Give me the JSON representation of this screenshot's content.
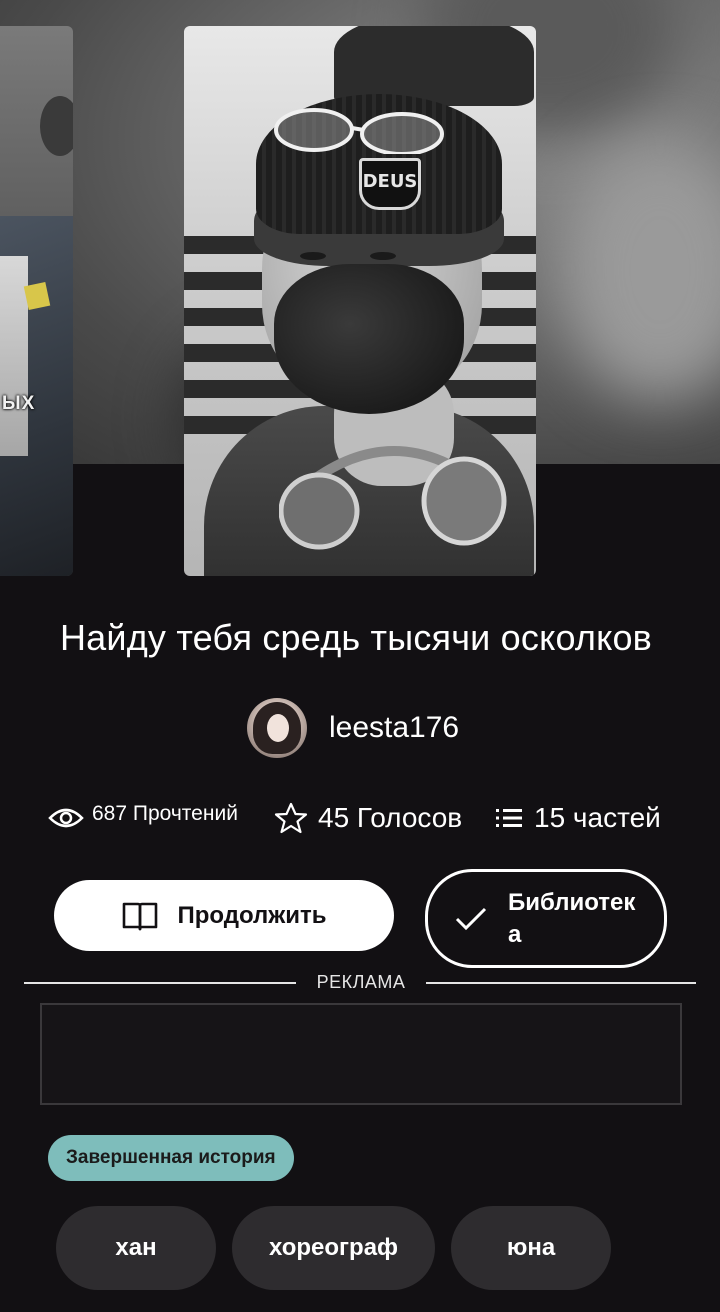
{
  "story": {
    "title": "Найду тебя средь тысячи осколков",
    "author": "leesta176",
    "side_cover_text": "ЫХ",
    "cover_badge_text": "DEUS"
  },
  "stats": {
    "reads": {
      "icon": "eye-icon",
      "label": "687 Прочтений"
    },
    "votes": {
      "icon": "star-icon",
      "label": "45 Голосов"
    },
    "parts": {
      "icon": "list-icon",
      "label": "15 частей"
    }
  },
  "actions": {
    "continue_label": "Продолжить",
    "continue_icon": "book-icon",
    "library_label": "Библиотека",
    "library_icon": "check-icon"
  },
  "ad": {
    "label": "РЕКЛАМА"
  },
  "status": {
    "label": "Завершенная история",
    "color": "#7ebdbb"
  },
  "tags": [
    "хан",
    "хореограф",
    "юна"
  ],
  "colors": {
    "background": "#121013",
    "pill_background": "#2e2c2f",
    "primary_button": "#ffffff"
  }
}
